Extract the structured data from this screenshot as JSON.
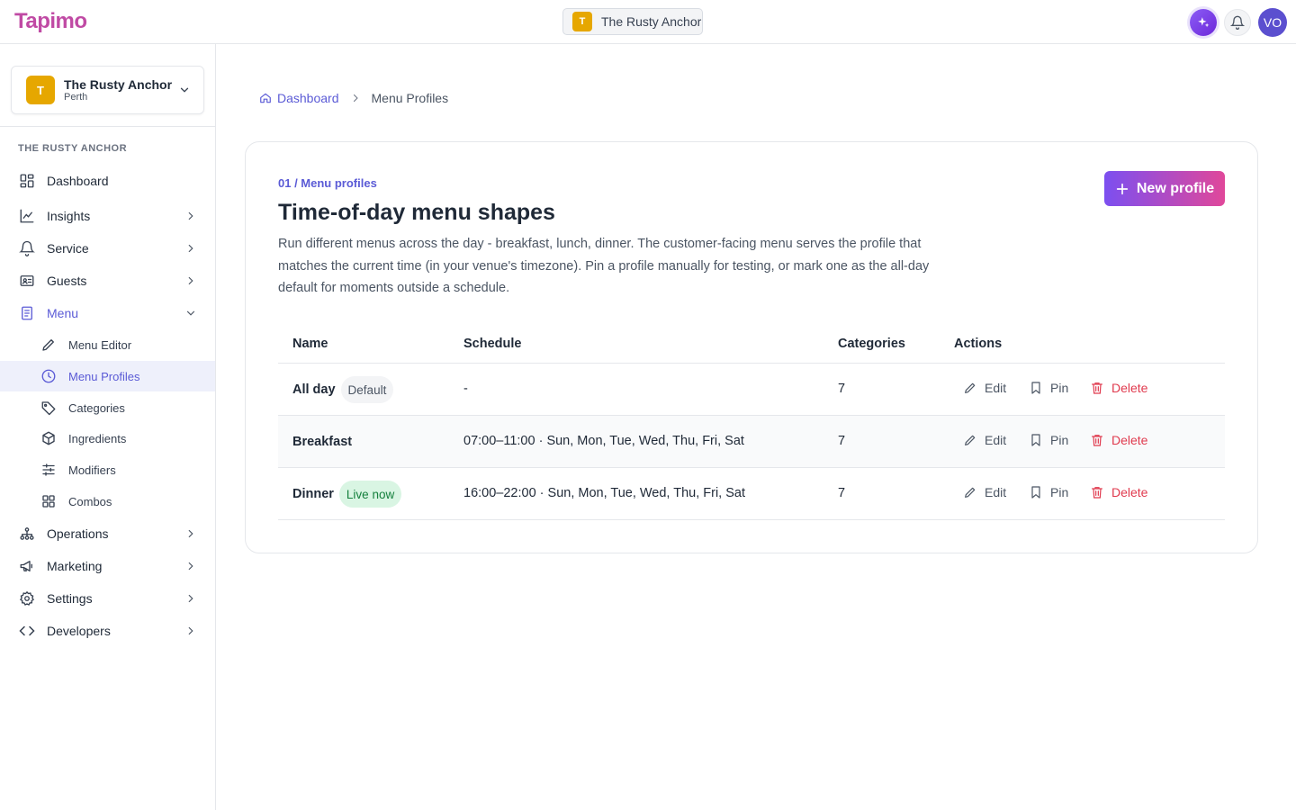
{
  "app": {
    "logo": "Tapimo"
  },
  "topbar": {
    "venue_initial": "T",
    "venue_name": "The Rusty Anchor",
    "avatar_initials": "VO"
  },
  "sidebar": {
    "venue": {
      "initial": "T",
      "name": "The Rusty Anchor",
      "city": "Perth"
    },
    "section_label": "THE RUSTY ANCHOR",
    "items": [
      {
        "label": "Dashboard",
        "icon": "dashboard-grid-icon"
      },
      {
        "label": "Insights",
        "icon": "chart-line-icon"
      },
      {
        "label": "Service",
        "icon": "bell-icon"
      },
      {
        "label": "Guests",
        "icon": "id-card-icon"
      },
      {
        "label": "Menu",
        "icon": "document-icon"
      },
      {
        "label": "Operations",
        "icon": "sitemap-icon"
      },
      {
        "label": "Marketing",
        "icon": "megaphone-icon"
      },
      {
        "label": "Settings",
        "icon": "gear-icon"
      },
      {
        "label": "Developers",
        "icon": "code-icon"
      }
    ],
    "menu_sub": [
      {
        "label": "Menu Editor",
        "icon": "pencil-icon"
      },
      {
        "label": "Menu Profiles",
        "icon": "clock-icon"
      },
      {
        "label": "Categories",
        "icon": "tag-icon"
      },
      {
        "label": "Ingredients",
        "icon": "box-icon"
      },
      {
        "label": "Modifiers",
        "icon": "sliders-icon"
      },
      {
        "label": "Combos",
        "icon": "grid-icon"
      }
    ]
  },
  "breadcrumb": {
    "home": "Dashboard",
    "current": "Menu Profiles"
  },
  "card": {
    "eyebrow": "01 / Menu profiles",
    "title": "Time-of-day menu shapes",
    "description": "Run different menus across the day - breakfast, lunch, dinner. The customer-facing menu serves the profile that matches the current time (in your venue's timezone). Pin a profile manually for testing, or mark one as the all-day default for moments outside a schedule.",
    "new_button": "New profile"
  },
  "table": {
    "headers": {
      "name": "Name",
      "schedule": "Schedule",
      "categories": "Categories",
      "actions": "Actions"
    },
    "rows": [
      {
        "name": "All day",
        "badge": "Default",
        "schedule": "-",
        "categories": "7"
      },
      {
        "name": "Breakfast",
        "badge": "",
        "schedule": "07:00–11:00 · Sun, Mon, Tue, Wed, Thu, Fri, Sat",
        "categories": "7"
      },
      {
        "name": "Dinner",
        "badge": "Live now",
        "schedule": "16:00–22:00 · Sun, Mon, Tue, Wed, Thu, Fri, Sat",
        "categories": "7"
      }
    ],
    "actions": {
      "edit": "Edit",
      "pin": "Pin",
      "delete": "Delete"
    }
  },
  "colors": {
    "accent": "#5b5bd6",
    "brand": "#c04aa4",
    "danger": "#e03a4e",
    "live_bg": "#d9f5e3",
    "venue_badge": "#e6a700"
  }
}
